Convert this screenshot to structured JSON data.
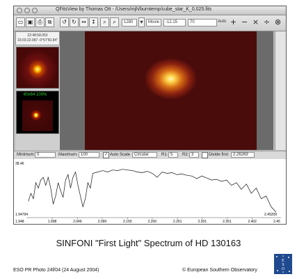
{
  "window": {
    "title": "QFitsView by Thomas Ott - /Users/mjh/burntemp/cube_star_K_0.025.fits"
  },
  "toolbar": {
    "zoom_value": "1280",
    "mode_value": "Movie",
    "field_a": "-12.15",
    "field_b": "70",
    "auto_label": "Auto",
    "plus_label": "+",
    "minus_label": "−",
    "times_label": "×",
    "divide_label": "÷",
    "close_label": "⊗"
  },
  "left_panel": {
    "coord_line1": "22:48:58.053",
    "coord_line2": "16:03:22.087  -0°57'50.84\"",
    "thumb2_label": "60x64  100%"
  },
  "controls": {
    "minimum_label": "Minimum:",
    "minimum_value": "0",
    "maximum_label": "Maximum:",
    "maximum_value": "100",
    "auto_scale_label": "Auto Scale",
    "circular_label": "Circular",
    "r1_label": "R1:",
    "r1_value": "5",
    "r2_label": "R2:",
    "r2_value": "3",
    "divide_label": "Divide first",
    "divide_value": "2.26269"
  },
  "chart_data": {
    "type": "line",
    "title": "",
    "xlabel": "",
    "ylabel": "",
    "xlim": [
      1.946,
      2.46
    ],
    "ylim": [
      1.94794,
      38.46
    ],
    "y_top_label": "38.46",
    "y_bottom_label": "1.94794",
    "x_ticks": [
      "1.998",
      "2.049",
      "2.099",
      "2.150",
      "2.200",
      "2.251",
      "2.301",
      "2.351",
      "2.402"
    ],
    "x_start_label": "1.948",
    "x_end_label": "2.45209",
    "x_end_label2": "2.45",
    "series": [
      {
        "x": [
          1.95,
          1.955,
          1.96,
          1.965,
          1.97,
          1.975,
          1.98,
          1.985,
          1.99,
          1.995,
          2.0,
          2.005,
          2.01,
          2.015,
          2.02,
          2.025,
          2.03,
          2.035,
          2.04,
          2.045,
          2.05,
          2.055,
          2.06,
          2.065,
          2.07,
          2.075,
          2.08,
          2.09,
          2.1,
          2.11,
          2.12,
          2.13,
          2.14,
          2.15,
          2.16,
          2.17,
          2.18,
          2.19,
          2.2,
          2.21,
          2.22,
          2.23,
          2.24,
          2.25,
          2.26,
          2.27,
          2.28,
          2.29,
          2.3,
          2.31,
          2.32,
          2.33,
          2.34,
          2.35,
          2.36,
          2.37,
          2.38,
          2.39,
          2.4,
          2.41,
          2.42,
          2.43,
          2.44,
          2.45
        ],
        "y": [
          12,
          18,
          14,
          26,
          22,
          28,
          30,
          24,
          30,
          22,
          10,
          16,
          26,
          20,
          15,
          28,
          32,
          22,
          30,
          34,
          24,
          16,
          8,
          14,
          26,
          22,
          33,
          34,
          35,
          34,
          35.5,
          35,
          36,
          35.5,
          35,
          34,
          33.5,
          34.5,
          33,
          30,
          34,
          33,
          33.5,
          32,
          32.5,
          31.5,
          31,
          29,
          31,
          29.5,
          28,
          28.5,
          27,
          28,
          24,
          26,
          21,
          25,
          18,
          22,
          14,
          16,
          8,
          4
        ]
      }
    ]
  },
  "caption": "SINFONI \"First Light\" Spectrum of HD 130163",
  "photo_id": "ESO PR Photo 24f/04 (24 August 2004)",
  "copyright": "© European Southern Observatory",
  "logo_text": "ESO"
}
